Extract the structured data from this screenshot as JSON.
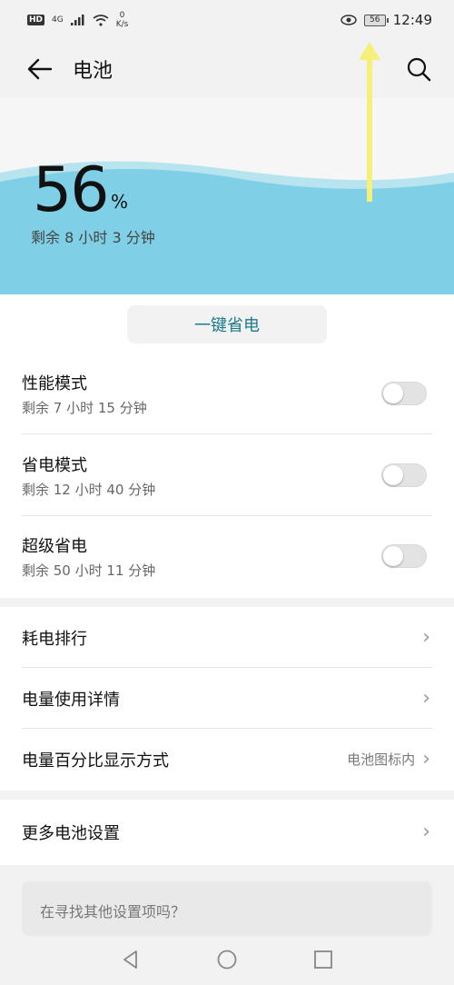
{
  "status_bar": {
    "hd": "HD",
    "network": "4G",
    "speed_value": "0",
    "speed_unit": "K/s",
    "battery": "56",
    "time": "12:49"
  },
  "app_bar": {
    "title": "电池"
  },
  "battery": {
    "percent": "56",
    "percent_sign": "%",
    "remaining": "剩余 8 小时 3 分钟"
  },
  "save_button": "一键省电",
  "modes": [
    {
      "label": "性能模式",
      "remaining": "剩余 7 小时 15 分钟",
      "enabled": false
    },
    {
      "label": "省电模式",
      "remaining": "剩余 12 小时 40 分钟",
      "enabled": false
    },
    {
      "label": "超级省电",
      "remaining": "剩余 50 小时 11 分钟",
      "enabled": false
    }
  ],
  "settings": [
    {
      "label": "耗电排行",
      "value": ""
    },
    {
      "label": "电量使用详情",
      "value": ""
    },
    {
      "label": "电量百分比显示方式",
      "value": "电池图标内"
    }
  ],
  "more": {
    "label": "更多电池设置"
  },
  "find": {
    "text": "在寻找其他设置项吗？"
  },
  "colors": {
    "accent": "#1a7a8a",
    "wave": "#7fd0e6",
    "annotation_arrow": "#f5f07a"
  }
}
